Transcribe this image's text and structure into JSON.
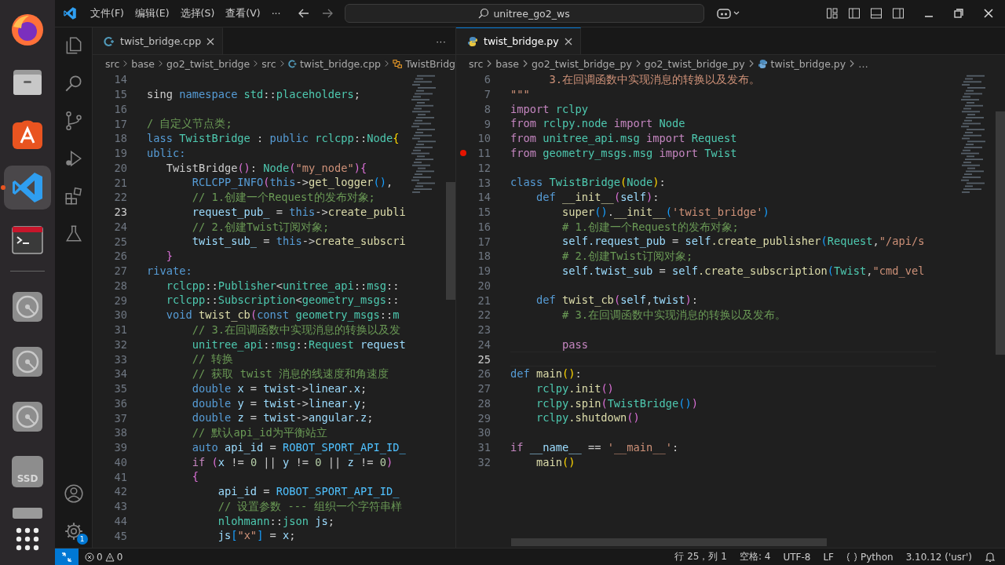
{
  "dock": {
    "apps": [
      {
        "kind": "browser",
        "running": false,
        "selected": false
      },
      {
        "kind": "files",
        "running": false,
        "selected": false
      },
      {
        "kind": "store",
        "running": false,
        "selected": false
      },
      {
        "kind": "editor",
        "running": true,
        "selected": true
      },
      {
        "kind": "terminal",
        "running": false,
        "selected": false
      }
    ],
    "devices": [
      {
        "kind": "disk"
      },
      {
        "kind": "disk"
      },
      {
        "kind": "disk"
      },
      {
        "kind": "ssd",
        "label": "SSD"
      },
      {
        "kind": "drive"
      }
    ]
  },
  "title_bar": {
    "menu": [
      "文件(F)",
      "编辑(E)",
      "选择(S)",
      "查看(V)",
      "···"
    ],
    "search": "unitree_go2_ws"
  },
  "activity_bar": {
    "settings_badge": "1"
  },
  "editors": [
    {
      "focused": false,
      "more": "···",
      "tabs": [
        {
          "label": "twist_bridge.cpp",
          "kind": "cpp",
          "selected": true
        }
      ],
      "breadcrumbs": [
        {
          "text": "src",
          "kind": "folder"
        },
        {
          "text": "base",
          "kind": "folder"
        },
        {
          "text": "go2_twist_bridge",
          "kind": "folder"
        },
        {
          "text": "src",
          "kind": "folder"
        },
        {
          "text": "twist_bridge.cpp",
          "kind": "cpp"
        },
        {
          "text": "TwistBridg",
          "kind": "symbol"
        }
      ],
      "lines": [
        {
          "num": "14",
          "current": false
        },
        {
          "num": "15",
          "current": false,
          "tokens": [
            {
              "text": "sing ",
              "kind": "pl"
            },
            {
              "text": "namespace ",
              "kind": "kw"
            },
            {
              "text": "std",
              "kind": "type"
            },
            {
              "text": "::",
              "kind": "pl"
            },
            {
              "text": "placeholders",
              "kind": "type"
            },
            {
              "text": ";",
              "kind": "pl"
            }
          ]
        },
        {
          "num": "16",
          "current": false
        },
        {
          "num": "17",
          "current": false,
          "tokens": [
            {
              "text": "/ 自定义节点类;",
              "kind": "cm"
            }
          ]
        },
        {
          "num": "18",
          "current": false,
          "tokens": [
            {
              "text": "lass ",
              "kind": "kw"
            },
            {
              "text": "TwistBridge",
              "kind": "type"
            },
            {
              "text": " : ",
              "kind": "pl"
            },
            {
              "text": "public ",
              "kind": "kw"
            },
            {
              "text": "rclcpp",
              "kind": "type"
            },
            {
              "text": "::",
              "kind": "pl"
            },
            {
              "text": "Node",
              "kind": "type"
            },
            {
              "text": "{",
              "kind": "br"
            }
          ]
        },
        {
          "num": "19",
          "current": false,
          "tokens": [
            {
              "text": "ublic:",
              "kind": "kw"
            }
          ]
        },
        {
          "num": "20",
          "current": false,
          "tokens": [
            {
              "text": "   TwistBridge",
              "kind": "pl"
            },
            {
              "text": "()",
              "kind": "br2"
            },
            {
              "text": ": ",
              "kind": "pl"
            },
            {
              "text": "Node",
              "kind": "type"
            },
            {
              "text": "(",
              "kind": "br2"
            },
            {
              "text": "\"my_node\"",
              "kind": "str"
            },
            {
              "text": "){",
              "kind": "br2"
            }
          ]
        },
        {
          "num": "21",
          "current": false,
          "tokens": [
            {
              "text": "       RCLCPP_INFO",
              "kind": "kw"
            },
            {
              "text": "(",
              "kind": "br2"
            },
            {
              "text": "this",
              "kind": "kw"
            },
            {
              "text": "->",
              "kind": "pl"
            },
            {
              "text": "get_logger",
              "kind": "fn"
            },
            {
              "text": "()",
              "kind": "br3"
            },
            {
              "text": ",",
              "kind": "pl"
            }
          ]
        },
        {
          "num": "22",
          "current": false,
          "tokens": [
            {
              "text": "       // 1.创建一个Request的发布对象;",
              "kind": "cm"
            }
          ]
        },
        {
          "num": "23",
          "current": true,
          "tokens": [
            {
              "text": "       request_pub_",
              "kind": "var"
            },
            {
              "text": " = ",
              "kind": "pl"
            },
            {
              "text": "this",
              "kind": "kw"
            },
            {
              "text": "->",
              "kind": "pl"
            },
            {
              "text": "create_publi",
              "kind": "fn"
            }
          ]
        },
        {
          "num": "24",
          "current": false,
          "tokens": [
            {
              "text": "       // 2.创建Twist订阅对象;",
              "kind": "cm"
            }
          ]
        },
        {
          "num": "25",
          "current": false,
          "tokens": [
            {
              "text": "       twist_sub_",
              "kind": "var"
            },
            {
              "text": " = ",
              "kind": "pl"
            },
            {
              "text": "this",
              "kind": "kw"
            },
            {
              "text": "->",
              "kind": "pl"
            },
            {
              "text": "create_subscri",
              "kind": "fn"
            }
          ]
        },
        {
          "num": "26",
          "current": false,
          "tokens": [
            {
              "text": "   }",
              "kind": "br2"
            }
          ]
        },
        {
          "num": "27",
          "current": false,
          "tokens": [
            {
              "text": "rivate:",
              "kind": "kw"
            }
          ]
        },
        {
          "num": "28",
          "current": false,
          "tokens": [
            {
              "text": "   rclcpp",
              "kind": "type"
            },
            {
              "text": "::",
              "kind": "pl"
            },
            {
              "text": "Publisher",
              "kind": "type"
            },
            {
              "text": "<",
              "kind": "pl"
            },
            {
              "text": "unitree_api",
              "kind": "type"
            },
            {
              "text": "::",
              "kind": "pl"
            },
            {
              "text": "msg",
              "kind": "type"
            },
            {
              "text": "::",
              "kind": "pl"
            }
          ]
        },
        {
          "num": "29",
          "current": false,
          "tokens": [
            {
              "text": "   rclcpp",
              "kind": "type"
            },
            {
              "text": "::",
              "kind": "pl"
            },
            {
              "text": "Subscription",
              "kind": "type"
            },
            {
              "text": "<",
              "kind": "pl"
            },
            {
              "text": "geometry_msgs",
              "kind": "type"
            },
            {
              "text": "::",
              "kind": "pl"
            }
          ]
        },
        {
          "num": "30",
          "current": false,
          "tokens": [
            {
              "text": "   void ",
              "kind": "kw"
            },
            {
              "text": "twist_cb",
              "kind": "fn"
            },
            {
              "text": "(",
              "kind": "br2"
            },
            {
              "text": "const ",
              "kind": "kw"
            },
            {
              "text": "geometry_msgs",
              "kind": "type"
            },
            {
              "text": "::",
              "kind": "pl"
            },
            {
              "text": "m",
              "kind": "type"
            }
          ]
        },
        {
          "num": "31",
          "current": false,
          "tokens": [
            {
              "text": "       // 3.在回调函数中实现消息的转换以及发",
              "kind": "cm"
            }
          ]
        },
        {
          "num": "32",
          "current": false,
          "tokens": [
            {
              "text": "       unitree_api",
              "kind": "type"
            },
            {
              "text": "::",
              "kind": "pl"
            },
            {
              "text": "msg",
              "kind": "type"
            },
            {
              "text": "::",
              "kind": "pl"
            },
            {
              "text": "Request ",
              "kind": "type"
            },
            {
              "text": "request",
              "kind": "var"
            }
          ]
        },
        {
          "num": "33",
          "current": false,
          "tokens": [
            {
              "text": "       // 转换",
              "kind": "cm"
            }
          ]
        },
        {
          "num": "34",
          "current": false,
          "tokens": [
            {
              "text": "       // 获取 twist 消息的线速度和角速度",
              "kind": "cm"
            }
          ]
        },
        {
          "num": "35",
          "current": false,
          "tokens": [
            {
              "text": "       double ",
              "kind": "kw"
            },
            {
              "text": "x",
              "kind": "var"
            },
            {
              "text": " = ",
              "kind": "pl"
            },
            {
              "text": "twist",
              "kind": "var"
            },
            {
              "text": "->",
              "kind": "pl"
            },
            {
              "text": "linear",
              "kind": "var"
            },
            {
              "text": ".",
              "kind": "pl"
            },
            {
              "text": "x",
              "kind": "var"
            },
            {
              "text": ";",
              "kind": "pl"
            }
          ]
        },
        {
          "num": "36",
          "current": false,
          "tokens": [
            {
              "text": "       double ",
              "kind": "kw"
            },
            {
              "text": "y",
              "kind": "var"
            },
            {
              "text": " = ",
              "kind": "pl"
            },
            {
              "text": "twist",
              "kind": "var"
            },
            {
              "text": "->",
              "kind": "pl"
            },
            {
              "text": "linear",
              "kind": "var"
            },
            {
              "text": ".",
              "kind": "pl"
            },
            {
              "text": "y",
              "kind": "var"
            },
            {
              "text": ";",
              "kind": "pl"
            }
          ]
        },
        {
          "num": "37",
          "current": false,
          "tokens": [
            {
              "text": "       double ",
              "kind": "kw"
            },
            {
              "text": "z",
              "kind": "var"
            },
            {
              "text": " = ",
              "kind": "pl"
            },
            {
              "text": "twist",
              "kind": "var"
            },
            {
              "text": "->",
              "kind": "pl"
            },
            {
              "text": "angular",
              "kind": "var"
            },
            {
              "text": ".",
              "kind": "pl"
            },
            {
              "text": "z",
              "kind": "var"
            },
            {
              "text": ";",
              "kind": "pl"
            }
          ]
        },
        {
          "num": "38",
          "current": false,
          "tokens": [
            {
              "text": "       // 默认api_id为平衡站立",
              "kind": "cm"
            }
          ]
        },
        {
          "num": "39",
          "current": false,
          "tokens": [
            {
              "text": "       auto ",
              "kind": "kw"
            },
            {
              "text": "api_id",
              "kind": "var"
            },
            {
              "text": " = ",
              "kind": "pl"
            },
            {
              "text": "ROBOT_SPORT_API_ID_",
              "kind": "const"
            }
          ]
        },
        {
          "num": "40",
          "current": false,
          "tokens": [
            {
              "text": "       if ",
              "kind": "ctl"
            },
            {
              "text": "(",
              "kind": "br2"
            },
            {
              "text": "x",
              "kind": "var"
            },
            {
              "text": " != ",
              "kind": "pl"
            },
            {
              "text": "0",
              "kind": "num"
            },
            {
              "text": " || ",
              "kind": "pl"
            },
            {
              "text": "y",
              "kind": "var"
            },
            {
              "text": " != ",
              "kind": "pl"
            },
            {
              "text": "0",
              "kind": "num"
            },
            {
              "text": " || ",
              "kind": "pl"
            },
            {
              "text": "z",
              "kind": "var"
            },
            {
              "text": " != ",
              "kind": "pl"
            },
            {
              "text": "0",
              "kind": "num"
            },
            {
              "text": ")",
              "kind": "br2"
            }
          ]
        },
        {
          "num": "41",
          "current": false,
          "tokens": [
            {
              "text": "       {",
              "kind": "br2"
            }
          ]
        },
        {
          "num": "42",
          "current": false,
          "tokens": [
            {
              "text": "           api_id",
              "kind": "var"
            },
            {
              "text": " = ",
              "kind": "pl"
            },
            {
              "text": "ROBOT_SPORT_API_ID_",
              "kind": "const"
            }
          ]
        },
        {
          "num": "43",
          "current": false,
          "tokens": [
            {
              "text": "           // 设置参数 --- 组织一个字符串样",
              "kind": "cm"
            }
          ]
        },
        {
          "num": "44",
          "current": false,
          "tokens": [
            {
              "text": "           nlohmann",
              "kind": "type"
            },
            {
              "text": "::",
              "kind": "pl"
            },
            {
              "text": "json ",
              "kind": "type"
            },
            {
              "text": "js",
              "kind": "var"
            },
            {
              "text": ";",
              "kind": "pl"
            }
          ]
        },
        {
          "num": "45",
          "current": false,
          "tokens": [
            {
              "text": "           js",
              "kind": "var"
            },
            {
              "text": "[",
              "kind": "br3"
            },
            {
              "text": "\"x\"",
              "kind": "str"
            },
            {
              "text": "]",
              "kind": "br3"
            },
            {
              "text": " = ",
              "kind": "pl"
            },
            {
              "text": "x",
              "kind": "var"
            },
            {
              "text": ";",
              "kind": "pl"
            }
          ]
        }
      ]
    },
    {
      "focused": true,
      "tabs": [
        {
          "label": "twist_bridge.py",
          "kind": "py",
          "selected": true
        }
      ],
      "breadcrumbs": [
        {
          "text": "src",
          "kind": "folder"
        },
        {
          "text": "base",
          "kind": "folder"
        },
        {
          "text": "go2_twist_bridge_py",
          "kind": "folder"
        },
        {
          "text": "go2_twist_bridge_py",
          "kind": "folder"
        },
        {
          "text": "twist_bridge.py",
          "kind": "py"
        },
        {
          "text": "…",
          "kind": "more"
        }
      ],
      "lines": [
        {
          "num": "6",
          "current": false,
          "breakpoint": false,
          "tokens": [
            {
              "text": "      3.在回调函数中实现消息的转换以及发布。",
              "kind": "str"
            }
          ]
        },
        {
          "num": "7",
          "current": false,
          "breakpoint": false,
          "tokens": [
            {
              "text": "\"\"\"",
              "kind": "str"
            }
          ]
        },
        {
          "num": "8",
          "current": false,
          "breakpoint": false,
          "tokens": [
            {
              "text": "import ",
              "kind": "ctl"
            },
            {
              "text": "rclpy",
              "kind": "type"
            }
          ]
        },
        {
          "num": "9",
          "current": false,
          "breakpoint": false,
          "tokens": [
            {
              "text": "from ",
              "kind": "ctl"
            },
            {
              "text": "rclpy.node ",
              "kind": "type"
            },
            {
              "text": "import ",
              "kind": "ctl"
            },
            {
              "text": "Node",
              "kind": "type"
            }
          ]
        },
        {
          "num": "10",
          "current": false,
          "breakpoint": false,
          "tokens": [
            {
              "text": "from ",
              "kind": "ctl"
            },
            {
              "text": "unitree_api.msg ",
              "kind": "type"
            },
            {
              "text": "import ",
              "kind": "ctl"
            },
            {
              "text": "Request",
              "kind": "type"
            }
          ]
        },
        {
          "num": "11",
          "current": false,
          "breakpoint": true,
          "tokens": [
            {
              "text": "from ",
              "kind": "ctl"
            },
            {
              "text": "geometry_msgs.msg ",
              "kind": "type"
            },
            {
              "text": "import ",
              "kind": "ctl"
            },
            {
              "text": "Twist",
              "kind": "type"
            }
          ]
        },
        {
          "num": "12",
          "current": false,
          "breakpoint": false
        },
        {
          "num": "13",
          "current": false,
          "breakpoint": false,
          "tokens": [
            {
              "text": "class ",
              "kind": "kw"
            },
            {
              "text": "TwistBridge",
              "kind": "type"
            },
            {
              "text": "(",
              "kind": "br"
            },
            {
              "text": "Node",
              "kind": "type"
            },
            {
              "text": ")",
              "kind": "br"
            },
            {
              "text": ":",
              "kind": "pl"
            }
          ]
        },
        {
          "num": "14",
          "current": false,
          "breakpoint": false,
          "tokens": [
            {
              "text": "    def ",
              "kind": "kw"
            },
            {
              "text": "__init__",
              "kind": "fn"
            },
            {
              "text": "(",
              "kind": "br2"
            },
            {
              "text": "self",
              "kind": "var"
            },
            {
              "text": ")",
              "kind": "br2"
            },
            {
              "text": ":",
              "kind": "pl"
            }
          ]
        },
        {
          "num": "15",
          "current": false,
          "breakpoint": false,
          "tokens": [
            {
              "text": "        super",
              "kind": "fn"
            },
            {
              "text": "()",
              "kind": "br3"
            },
            {
              "text": ".",
              "kind": "pl"
            },
            {
              "text": "__init__",
              "kind": "fn"
            },
            {
              "text": "(",
              "kind": "br3"
            },
            {
              "text": "'twist_bridge'",
              "kind": "str"
            },
            {
              "text": ")",
              "kind": "br3"
            }
          ]
        },
        {
          "num": "16",
          "current": false,
          "breakpoint": false,
          "tokens": [
            {
              "text": "        # 1.创建一个Request的发布对象;",
              "kind": "cm"
            }
          ]
        },
        {
          "num": "17",
          "current": false,
          "breakpoint": false,
          "tokens": [
            {
              "text": "        self",
              "kind": "var"
            },
            {
              "text": ".request_pub",
              "kind": "var"
            },
            {
              "text": " = ",
              "kind": "pl"
            },
            {
              "text": "self",
              "kind": "var"
            },
            {
              "text": ".create_publisher",
              "kind": "fn"
            },
            {
              "text": "(",
              "kind": "br3"
            },
            {
              "text": "Request",
              "kind": "type"
            },
            {
              "text": ",",
              "kind": "pl"
            },
            {
              "text": "\"/api/s",
              "kind": "str"
            }
          ]
        },
        {
          "num": "18",
          "current": false,
          "breakpoint": false,
          "tokens": [
            {
              "text": "        # 2.创建Twist订阅对象;",
              "kind": "cm"
            }
          ]
        },
        {
          "num": "19",
          "current": false,
          "breakpoint": false,
          "tokens": [
            {
              "text": "        self",
              "kind": "var"
            },
            {
              "text": ".twist_sub",
              "kind": "var"
            },
            {
              "text": " = ",
              "kind": "pl"
            },
            {
              "text": "self",
              "kind": "var"
            },
            {
              "text": ".create_subscription",
              "kind": "fn"
            },
            {
              "text": "(",
              "kind": "br3"
            },
            {
              "text": "Twist",
              "kind": "type"
            },
            {
              "text": ",",
              "kind": "pl"
            },
            {
              "text": "\"cmd_vel",
              "kind": "str"
            }
          ]
        },
        {
          "num": "20",
          "current": false,
          "breakpoint": false
        },
        {
          "num": "21",
          "current": false,
          "breakpoint": false,
          "tokens": [
            {
              "text": "    def ",
              "kind": "kw"
            },
            {
              "text": "twist_cb",
              "kind": "fn"
            },
            {
              "text": "(",
              "kind": "br2"
            },
            {
              "text": "self",
              "kind": "var"
            },
            {
              "text": ",",
              "kind": "pl"
            },
            {
              "text": "twist",
              "kind": "var"
            },
            {
              "text": ")",
              "kind": "br2"
            },
            {
              "text": ":",
              "kind": "pl"
            }
          ]
        },
        {
          "num": "22",
          "current": false,
          "breakpoint": false,
          "tokens": [
            {
              "text": "        # 3.在回调函数中实现消息的转换以及发布。",
              "kind": "cm"
            }
          ]
        },
        {
          "num": "23",
          "current": false,
          "breakpoint": false
        },
        {
          "num": "24",
          "current": false,
          "breakpoint": false,
          "tokens": [
            {
              "text": "        pass",
              "kind": "ctl"
            }
          ]
        },
        {
          "num": "25",
          "current": true,
          "breakpoint": false
        },
        {
          "num": "26",
          "current": false,
          "breakpoint": false,
          "tokens": [
            {
              "text": "def ",
              "kind": "kw"
            },
            {
              "text": "main",
              "kind": "fn"
            },
            {
              "text": "()",
              "kind": "br"
            },
            {
              "text": ":",
              "kind": "pl"
            }
          ]
        },
        {
          "num": "27",
          "current": false,
          "breakpoint": false,
          "tokens": [
            {
              "text": "    rclpy",
              "kind": "type"
            },
            {
              "text": ".init",
              "kind": "fn"
            },
            {
              "text": "()",
              "kind": "br2"
            }
          ]
        },
        {
          "num": "28",
          "current": false,
          "breakpoint": false,
          "tokens": [
            {
              "text": "    rclpy",
              "kind": "type"
            },
            {
              "text": ".spin",
              "kind": "fn"
            },
            {
              "text": "(",
              "kind": "br2"
            },
            {
              "text": "TwistBridge",
              "kind": "type"
            },
            {
              "text": "()",
              "kind": "br3"
            },
            {
              "text": ")",
              "kind": "br2"
            }
          ]
        },
        {
          "num": "29",
          "current": false,
          "breakpoint": false,
          "tokens": [
            {
              "text": "    rclpy",
              "kind": "type"
            },
            {
              "text": ".shutdown",
              "kind": "fn"
            },
            {
              "text": "()",
              "kind": "br2"
            }
          ]
        },
        {
          "num": "30",
          "current": false,
          "breakpoint": false
        },
        {
          "num": "31",
          "current": false,
          "breakpoint": false,
          "tokens": [
            {
              "text": "if ",
              "kind": "ctl"
            },
            {
              "text": "__name__",
              "kind": "var"
            },
            {
              "text": " == ",
              "kind": "pl"
            },
            {
              "text": "'__main__'",
              "kind": "str"
            },
            {
              "text": ":",
              "kind": "pl"
            }
          ]
        },
        {
          "num": "32",
          "current": false,
          "breakpoint": false,
          "tokens": [
            {
              "text": "    main",
              "kind": "fn"
            },
            {
              "text": "()",
              "kind": "br"
            }
          ]
        }
      ]
    }
  ],
  "status_bar": {
    "errors": "0",
    "warnings": "0",
    "items": [
      {
        "text": "行 25，列 1",
        "kind": "plain"
      },
      {
        "text": "空格: 4",
        "kind": "plain"
      },
      {
        "text": "UTF-8",
        "kind": "plain"
      },
      {
        "text": "LF",
        "kind": "plain"
      },
      {
        "text": "Python",
        "kind": "language"
      },
      {
        "text": "3.10.12 ('usr')",
        "kind": "plain"
      }
    ]
  }
}
